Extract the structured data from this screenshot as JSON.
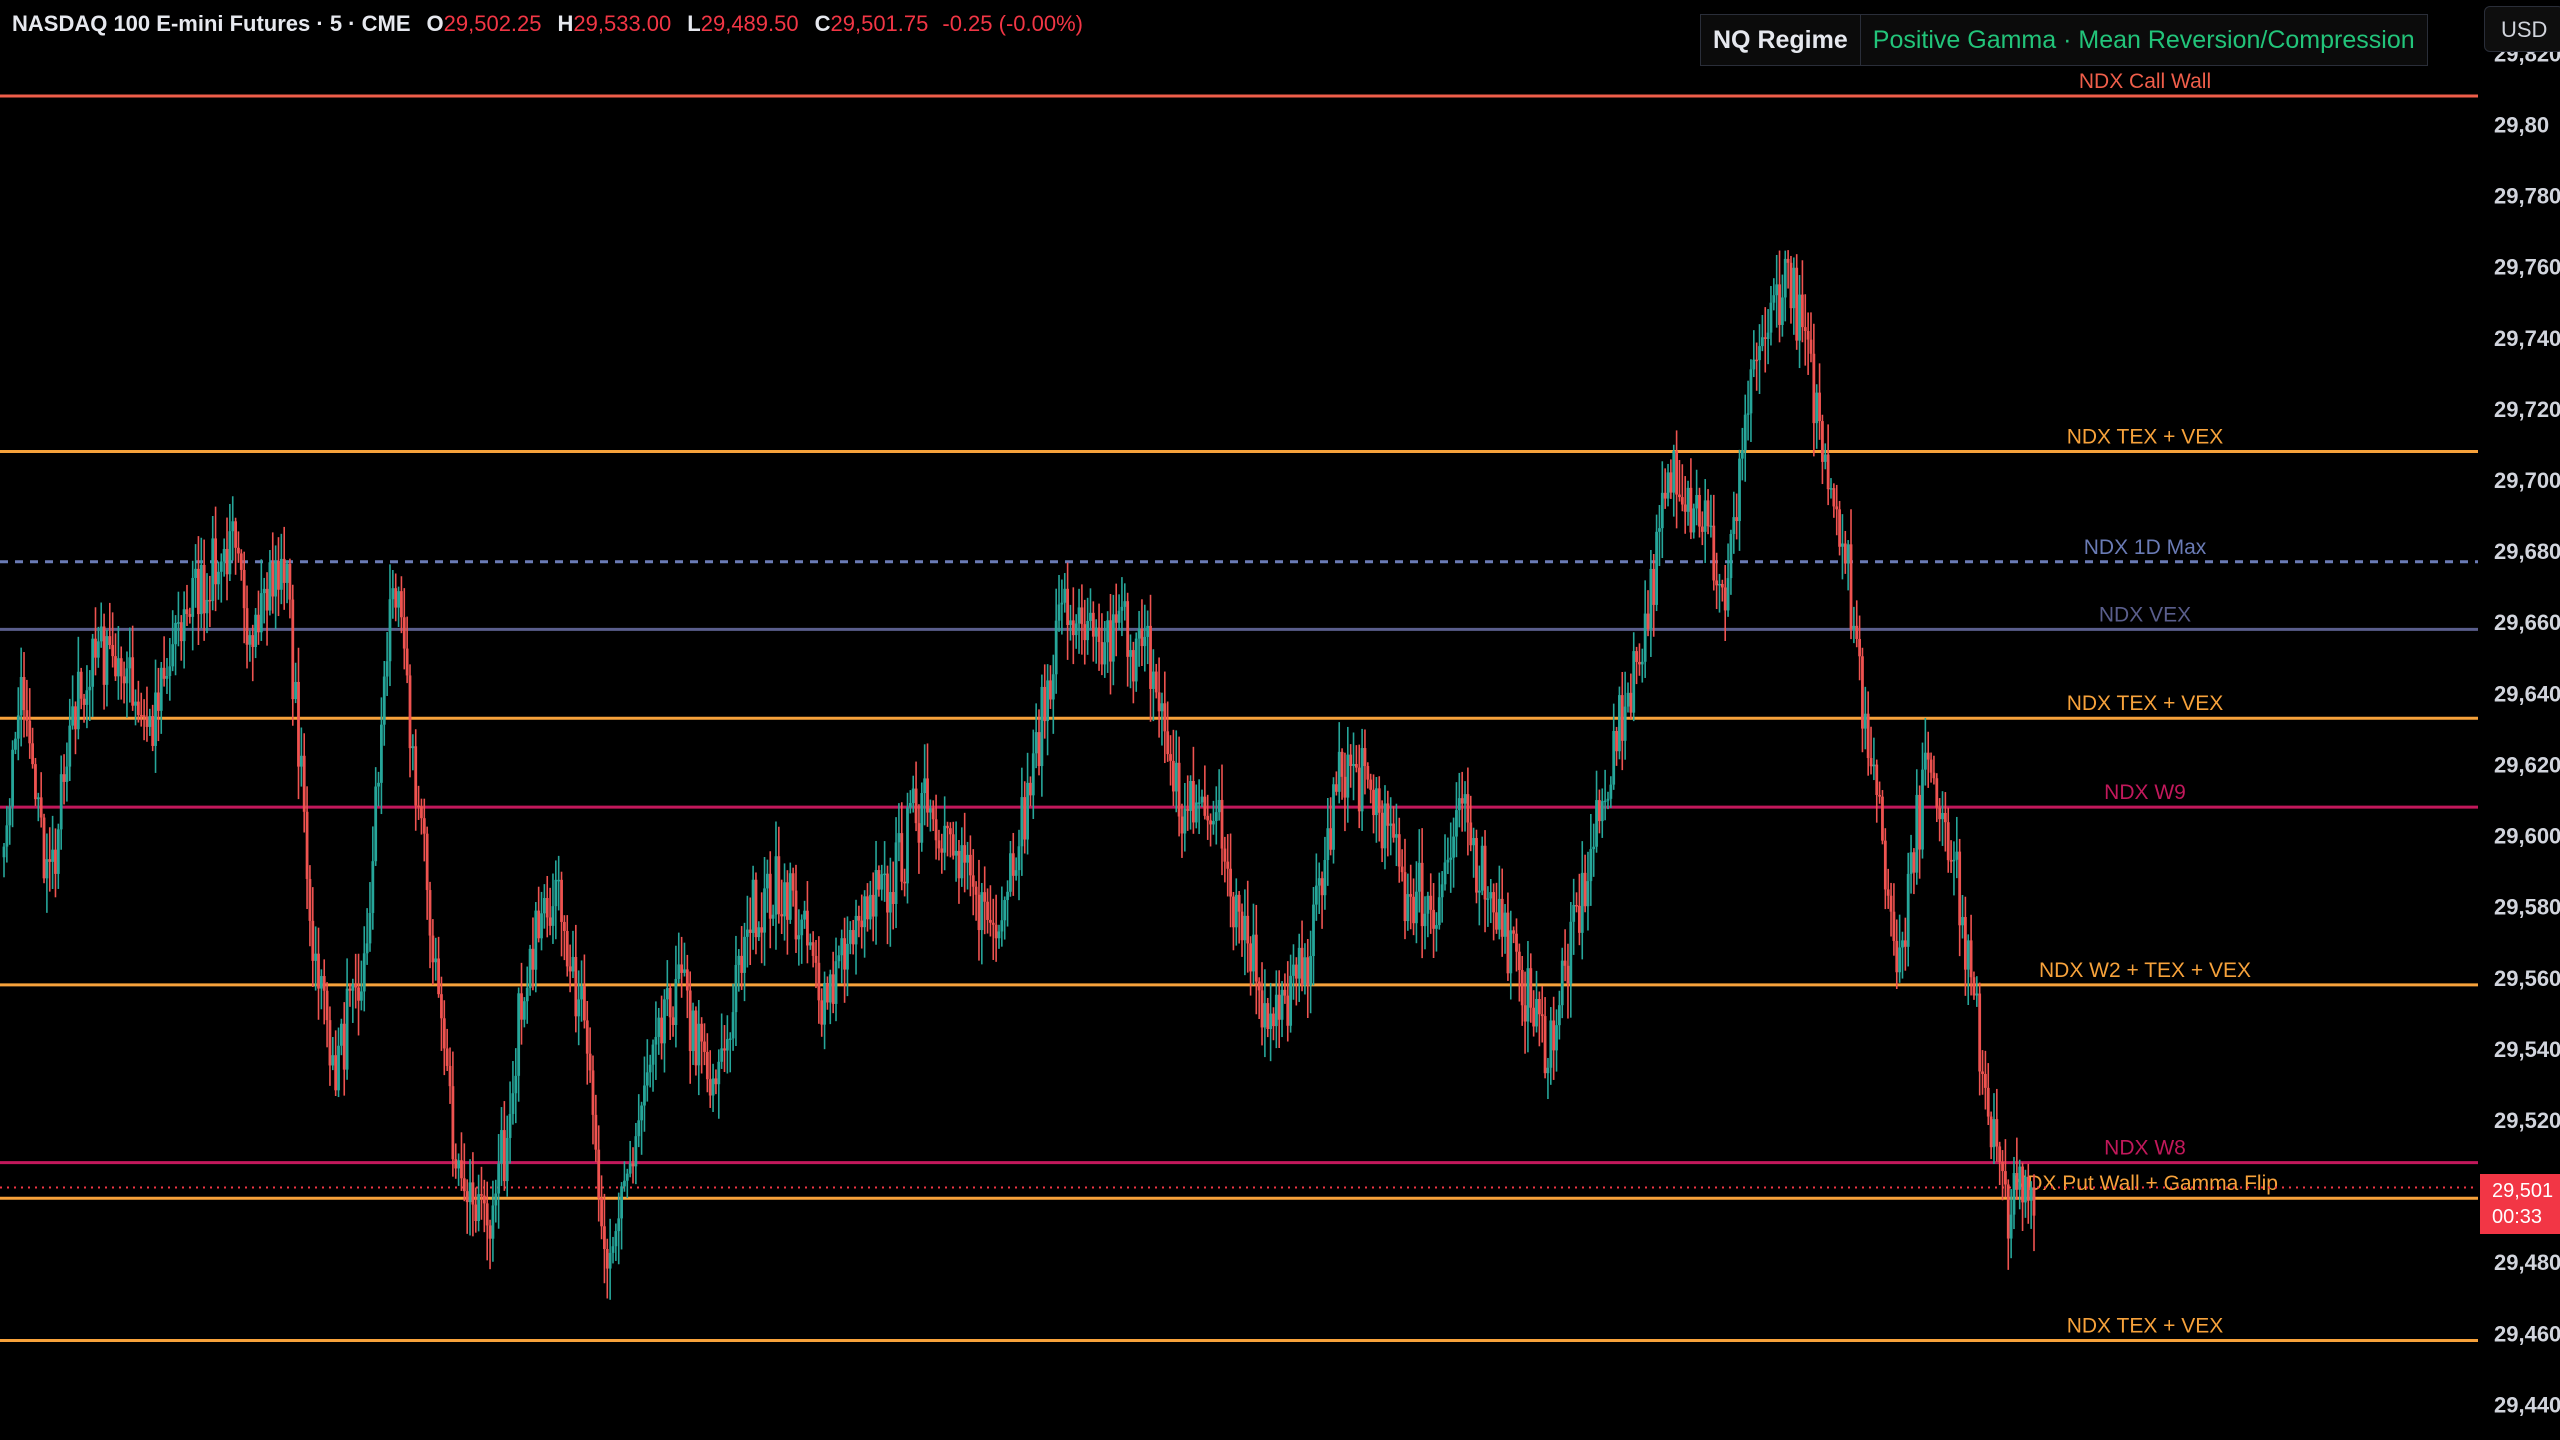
{
  "header": {
    "symbol": "NASDAQ 100 E-mini Futures · 5 · CME",
    "ohlc": [
      {
        "key": "O",
        "value": "29,502.25"
      },
      {
        "key": "H",
        "value": "29,533.00"
      },
      {
        "key": "L",
        "value": "29,489.50"
      },
      {
        "key": "C",
        "value": "29,501.75"
      }
    ],
    "change": "-0.25 (-0.00%)"
  },
  "regime": {
    "key": "NQ Regime",
    "value": "Positive Gamma · Mean Reversion/Compression"
  },
  "currency": "USD",
  "last_price": {
    "price": "29,501",
    "countdown": "00:33"
  },
  "colors": {
    "up": "#26a69a",
    "down": "#ef5350",
    "background": "#000000"
  },
  "chart_data": {
    "type": "candlestick",
    "y_axis": {
      "ylim": [
        29430,
        29835
      ],
      "ticks": [
        29820,
        29800,
        29780,
        29760,
        29740,
        29720,
        29700,
        29680,
        29660,
        29640,
        29620,
        29600,
        29580,
        29560,
        29540,
        29520,
        29480,
        29460,
        29440
      ],
      "tick_labels": [
        "29,820",
        "29,80",
        "29,780",
        "29,760",
        "29,740",
        "29,720",
        "29,700",
        "29,680",
        "29,660",
        "29,640",
        "29,620",
        "29,600",
        "29,580",
        "29,560",
        "29,540",
        "29,520",
        "29,480",
        "29,460",
        "29,440"
      ]
    },
    "levels": [
      {
        "label": "NDX Call Wall",
        "price": 29808,
        "color": "#ef5e4a",
        "style": "solid"
      },
      {
        "label": "NDX TEX + VEX",
        "price": 29708,
        "color": "#f7a23b",
        "style": "solid"
      },
      {
        "label": "NDX 1D Max",
        "price": 29677,
        "color": "#6a7bb5",
        "style": "dashed"
      },
      {
        "label": "NDX VEX",
        "price": 29658,
        "color": "#5a5e8c",
        "style": "solid"
      },
      {
        "label": "NDX TEX + VEX",
        "price": 29633,
        "color": "#f7a23b",
        "style": "solid"
      },
      {
        "label": "NDX W9",
        "price": 29608,
        "color": "#c2185b",
        "style": "solid"
      },
      {
        "label": "NDX W2 + TEX + VEX",
        "price": 29558,
        "color": "#f7a23b",
        "style": "solid"
      },
      {
        "label": "NDX W8",
        "price": 29508,
        "color": "#c2185b",
        "style": "solid"
      },
      {
        "label": "NDX Put Wall + Gamma Flip",
        "price": 29498,
        "color": "#f7a23b",
        "style": "solid"
      },
      {
        "label": "NDX TEX + VEX",
        "price": 29458,
        "color": "#f7a23b",
        "style": "solid"
      }
    ],
    "path_anchors": [
      {
        "i": 0,
        "p": 29600
      },
      {
        "i": 6,
        "p": 29640
      },
      {
        "i": 16,
        "p": 29585
      },
      {
        "i": 26,
        "p": 29640
      },
      {
        "i": 36,
        "p": 29655
      },
      {
        "i": 52,
        "p": 29630
      },
      {
        "i": 64,
        "p": 29665
      },
      {
        "i": 78,
        "p": 29680
      },
      {
        "i": 88,
        "p": 29660
      },
      {
        "i": 98,
        "p": 29680
      },
      {
        "i": 108,
        "p": 29570
      },
      {
        "i": 116,
        "p": 29535
      },
      {
        "i": 126,
        "p": 29560
      },
      {
        "i": 136,
        "p": 29675
      },
      {
        "i": 146,
        "p": 29600
      },
      {
        "i": 158,
        "p": 29510
      },
      {
        "i": 170,
        "p": 29485
      },
      {
        "i": 182,
        "p": 29560
      },
      {
        "i": 192,
        "p": 29585
      },
      {
        "i": 202,
        "p": 29555
      },
      {
        "i": 212,
        "p": 29475
      },
      {
        "i": 222,
        "p": 29520
      },
      {
        "i": 236,
        "p": 29560
      },
      {
        "i": 248,
        "p": 29525
      },
      {
        "i": 262,
        "p": 29580
      },
      {
        "i": 274,
        "p": 29585
      },
      {
        "i": 286,
        "p": 29555
      },
      {
        "i": 296,
        "p": 29570
      },
      {
        "i": 310,
        "p": 29585
      },
      {
        "i": 322,
        "p": 29615
      },
      {
        "i": 334,
        "p": 29590
      },
      {
        "i": 346,
        "p": 29575
      },
      {
        "i": 358,
        "p": 29610
      },
      {
        "i": 370,
        "p": 29665
      },
      {
        "i": 382,
        "p": 29650
      },
      {
        "i": 392,
        "p": 29660
      },
      {
        "i": 402,
        "p": 29645
      },
      {
        "i": 412,
        "p": 29605
      },
      {
        "i": 422,
        "p": 29610
      },
      {
        "i": 434,
        "p": 29575
      },
      {
        "i": 444,
        "p": 29545
      },
      {
        "i": 456,
        "p": 29565
      },
      {
        "i": 468,
        "p": 29620
      },
      {
        "i": 480,
        "p": 29610
      },
      {
        "i": 490,
        "p": 29585
      },
      {
        "i": 500,
        "p": 29580
      },
      {
        "i": 510,
        "p": 29605
      },
      {
        "i": 520,
        "p": 29585
      },
      {
        "i": 530,
        "p": 29560
      },
      {
        "i": 540,
        "p": 29540
      },
      {
        "i": 550,
        "p": 29575
      },
      {
        "i": 562,
        "p": 29620
      },
      {
        "i": 574,
        "p": 29660
      },
      {
        "i": 584,
        "p": 29705
      },
      {
        "i": 594,
        "p": 29690
      },
      {
        "i": 602,
        "p": 29665
      },
      {
        "i": 612,
        "p": 29730
      },
      {
        "i": 624,
        "p": 29760
      },
      {
        "i": 634,
        "p": 29720
      },
      {
        "i": 642,
        "p": 29690
      },
      {
        "i": 652,
        "p": 29630
      },
      {
        "i": 662,
        "p": 29565
      },
      {
        "i": 672,
        "p": 29620
      },
      {
        "i": 680,
        "p": 29605
      },
      {
        "i": 690,
        "p": 29545
      },
      {
        "i": 700,
        "p": 29495
      },
      {
        "i": 710,
        "p": 29501
      }
    ]
  }
}
